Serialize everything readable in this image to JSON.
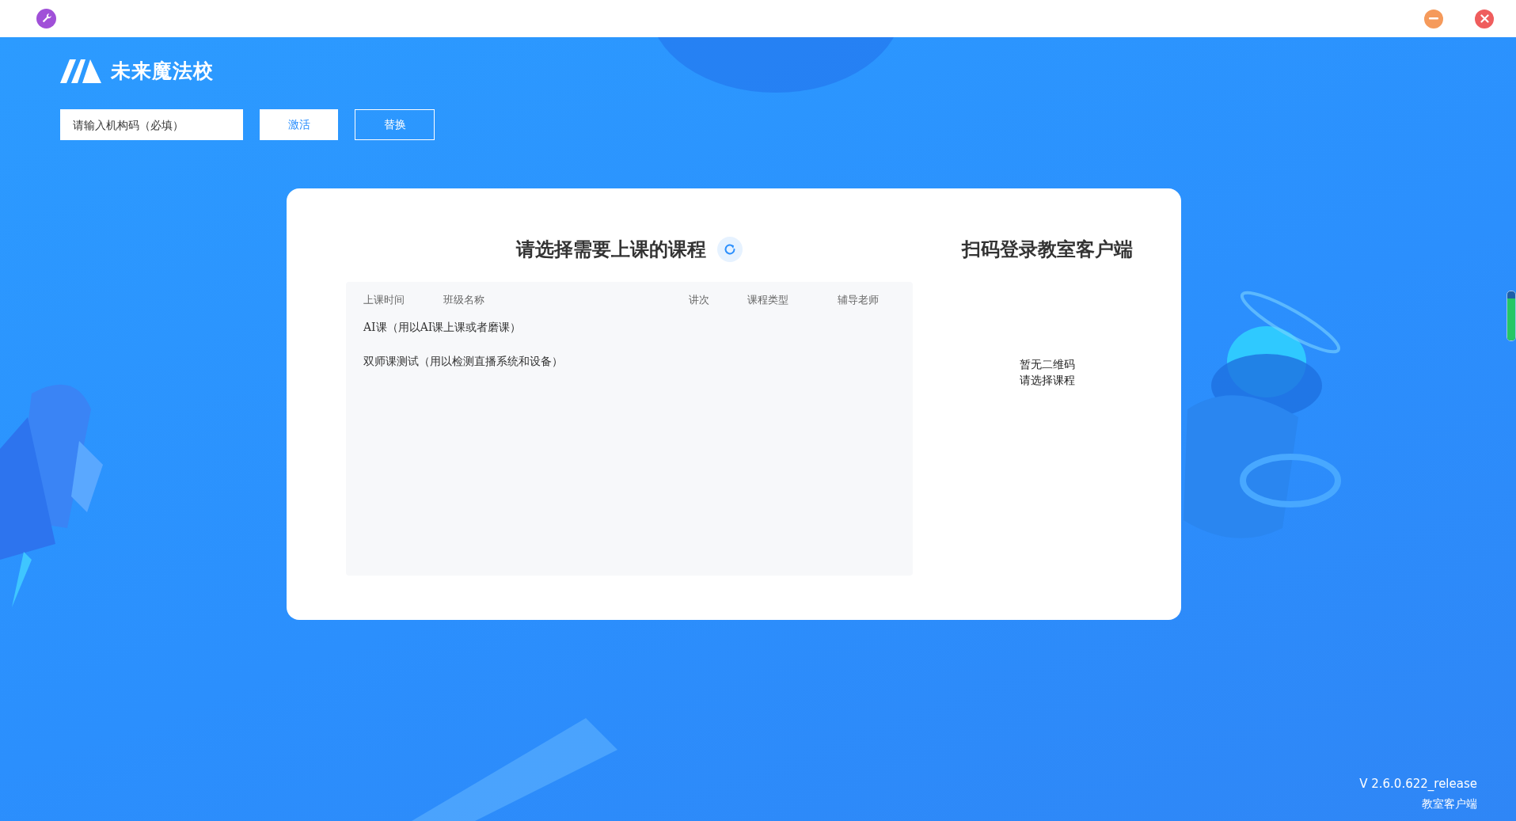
{
  "brand": {
    "name": "未来魔法校"
  },
  "activation": {
    "placeholder": "请输入机构码（必填）",
    "buttons": [
      {
        "label": "激活",
        "kind": "filled"
      },
      {
        "label": "替换",
        "kind": "outline"
      }
    ]
  },
  "course_panel": {
    "title": "请选择需要上课的课程",
    "columns": [
      "上课时间",
      "班级名称",
      "讲次",
      "课程类型",
      "辅导老师"
    ],
    "rows": [
      {
        "label": "AI课（用以AI课上课或者磨课）"
      },
      {
        "label": "双师课测试（用以检测直播系统和设备）"
      }
    ]
  },
  "qr_panel": {
    "title": "扫码登录教室客户端",
    "messages": [
      "暂无二维码",
      "请选择课程"
    ]
  },
  "side_meter": {
    "level": 0.85
  },
  "footer": {
    "version": "V 2.6.0.622_release",
    "product": "教室客户端"
  }
}
